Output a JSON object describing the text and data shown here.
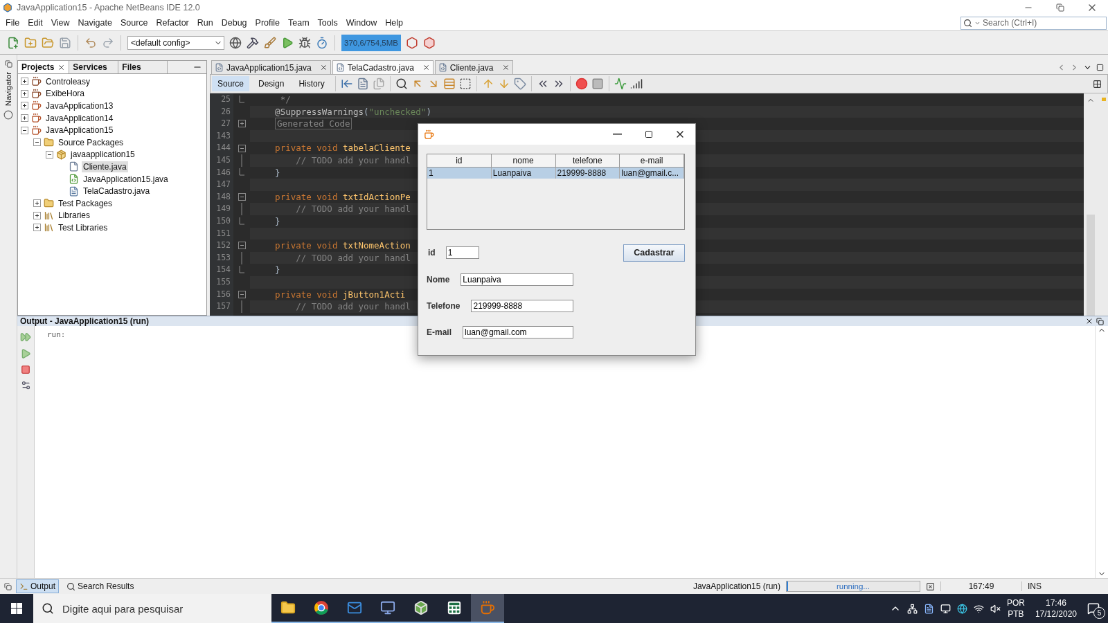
{
  "window": {
    "title": "JavaApplication15 - Apache NetBeans IDE 12.0"
  },
  "menu": [
    "File",
    "Edit",
    "View",
    "Navigate",
    "Source",
    "Refactor",
    "Run",
    "Debug",
    "Profile",
    "Team",
    "Tools",
    "Window",
    "Help"
  ],
  "search": {
    "placeholder": "Search (Ctrl+I)"
  },
  "toolbar": {
    "config": "<default config>",
    "memory": "370,6/754,5MB"
  },
  "navigator": {
    "label": "Navigator"
  },
  "projects_panel": {
    "tabs": [
      {
        "label": "Projects",
        "selected": true
      },
      {
        "label": "Services",
        "selected": false
      },
      {
        "label": "Files",
        "selected": false
      }
    ],
    "tree": [
      {
        "label": "Controleasy",
        "kind": "project-fx",
        "expanded": false,
        "selected": false
      },
      {
        "label": "ExibeHora",
        "kind": "project-fx",
        "expanded": false,
        "selected": false
      },
      {
        "label": "JavaApplication13",
        "kind": "project",
        "expanded": false,
        "selected": false
      },
      {
        "label": "JavaApplication14",
        "kind": "project",
        "expanded": false,
        "selected": false
      },
      {
        "label": "JavaApplication15",
        "kind": "project",
        "expanded": true,
        "selected": false,
        "children": [
          {
            "label": "Source Packages",
            "kind": "folder",
            "expanded": true,
            "selected": false,
            "children": [
              {
                "label": "javaapplication15",
                "kind": "package",
                "expanded": true,
                "selected": false,
                "children": [
                  {
                    "label": "Cliente.java",
                    "kind": "class",
                    "selected": true
                  },
                  {
                    "label": "JavaApplication15.java",
                    "kind": "main",
                    "selected": false
                  },
                  {
                    "label": "TelaCadastro.java",
                    "kind": "form",
                    "selected": false
                  }
                ]
              }
            ]
          },
          {
            "label": "Test Packages",
            "kind": "folder",
            "expanded": false,
            "selected": false
          },
          {
            "label": "Libraries",
            "kind": "library",
            "expanded": false,
            "selected": false
          },
          {
            "label": "Test Libraries",
            "kind": "library",
            "expanded": false,
            "selected": false
          }
        ]
      }
    ]
  },
  "editor": {
    "tabs": [
      {
        "label": "JavaApplication15.java",
        "selected": false
      },
      {
        "label": "TelaCadastro.java",
        "selected": true
      },
      {
        "label": "Cliente.java",
        "selected": false
      }
    ],
    "views": [
      {
        "label": "Source",
        "selected": true
      },
      {
        "label": "Design",
        "selected": false
      },
      {
        "label": "History",
        "selected": false
      }
    ],
    "lines": [
      {
        "number": "25",
        "kind": "close",
        "tokens": [
          {
            "kind": "comment",
            "text": "     */"
          }
        ]
      },
      {
        "number": "26",
        "kind": "none",
        "tokens": [
          {
            "kind": "annotation",
            "text": "    @SuppressWarnings"
          },
          {
            "kind": "plain",
            "text": "("
          },
          {
            "kind": "string",
            "text": "\"unchecked\""
          },
          {
            "kind": "plain",
            "text": ")"
          }
        ]
      },
      {
        "number": "27",
        "kind": "collapsed",
        "tokens": [
          {
            "kind": "folded",
            "text": "Generated Code"
          }
        ]
      },
      {
        "number": "143",
        "kind": "none"
      },
      {
        "number": "144",
        "kind": "open",
        "tokens": [
          {
            "kind": "keyword",
            "text": "    private void "
          },
          {
            "kind": "method",
            "text": "tabelaCliente"
          }
        ]
      },
      {
        "number": "145",
        "kind": "line",
        "tokens": [
          {
            "kind": "comment",
            "text": "        // TODO add your handl"
          }
        ]
      },
      {
        "number": "146",
        "kind": "close",
        "tokens": [
          {
            "kind": "plain",
            "text": "    }"
          }
        ]
      },
      {
        "number": "147",
        "kind": "none"
      },
      {
        "number": "148",
        "kind": "open",
        "tokens": [
          {
            "kind": "keyword",
            "text": "    private void "
          },
          {
            "kind": "method",
            "text": "txtIdActionPe"
          }
        ]
      },
      {
        "number": "149",
        "kind": "line",
        "tokens": [
          {
            "kind": "comment",
            "text": "        // TODO add your handl"
          }
        ]
      },
      {
        "number": "150",
        "kind": "close",
        "tokens": [
          {
            "kind": "plain",
            "text": "    }"
          }
        ]
      },
      {
        "number": "151",
        "kind": "none"
      },
      {
        "number": "152",
        "kind": "open",
        "tokens": [
          {
            "kind": "keyword",
            "text": "    private void "
          },
          {
            "kind": "method",
            "text": "txtNomeAction"
          }
        ]
      },
      {
        "number": "153",
        "kind": "line",
        "tokens": [
          {
            "kind": "comment",
            "text": "        // TODO add your handl"
          }
        ]
      },
      {
        "number": "154",
        "kind": "close",
        "tokens": [
          {
            "kind": "plain",
            "text": "    }"
          }
        ]
      },
      {
        "number": "155",
        "kind": "none"
      },
      {
        "number": "156",
        "kind": "open",
        "tokens": [
          {
            "kind": "keyword",
            "text": "    private void "
          },
          {
            "kind": "method",
            "text": "jButton1Acti"
          }
        ]
      },
      {
        "number": "157",
        "kind": "line",
        "tokens": [
          {
            "kind": "comment",
            "text": "        // TODO add your handl"
          }
        ]
      }
    ]
  },
  "dialog": {
    "table": {
      "columns": [
        "id",
        "nome",
        "telefone",
        "e-mail"
      ],
      "rows": [
        {
          "cells": [
            "1",
            "Luanpaiva",
            "219999-8888",
            "luan@gmail.c..."
          ],
          "selected": true
        }
      ]
    },
    "id_field": {
      "label": "id",
      "value": "1"
    },
    "button": "Cadastrar",
    "fields": [
      {
        "label": "Nome",
        "value": "Luanpaiva"
      },
      {
        "label": "Telefone",
        "value": "219999-8888"
      },
      {
        "label": "E-mail",
        "value": "luan@gmail.com"
      }
    ]
  },
  "output": {
    "title": "Output - JavaApplication15 (run)",
    "lines": [
      "run:"
    ]
  },
  "status_bar": {
    "tabs": [
      {
        "label": "Output",
        "kind": "output",
        "selected": true
      },
      {
        "label": "Search Results",
        "kind": "search",
        "selected": false
      }
    ],
    "task": "JavaApplication15 (run)",
    "progress": {
      "text": "running...",
      "level": 0.01
    },
    "position": "167:49",
    "mode": "INS"
  },
  "taskbar": {
    "search": {
      "placeholder": "Digite aqui para pesquisar"
    },
    "apps": [
      {
        "kind": "folder",
        "selected": false
      },
      {
        "kind": "browser",
        "selected": false
      },
      {
        "kind": "mail",
        "selected": false
      },
      {
        "kind": "monitor",
        "selected": false
      },
      {
        "kind": "cube",
        "selected": false
      },
      {
        "kind": "sheet",
        "selected": false
      },
      {
        "kind": "java",
        "selected": true
      }
    ],
    "language": [
      "POR",
      "PTB"
    ],
    "time": "17:46",
    "date": "17/12/2020",
    "notifications": "5"
  }
}
